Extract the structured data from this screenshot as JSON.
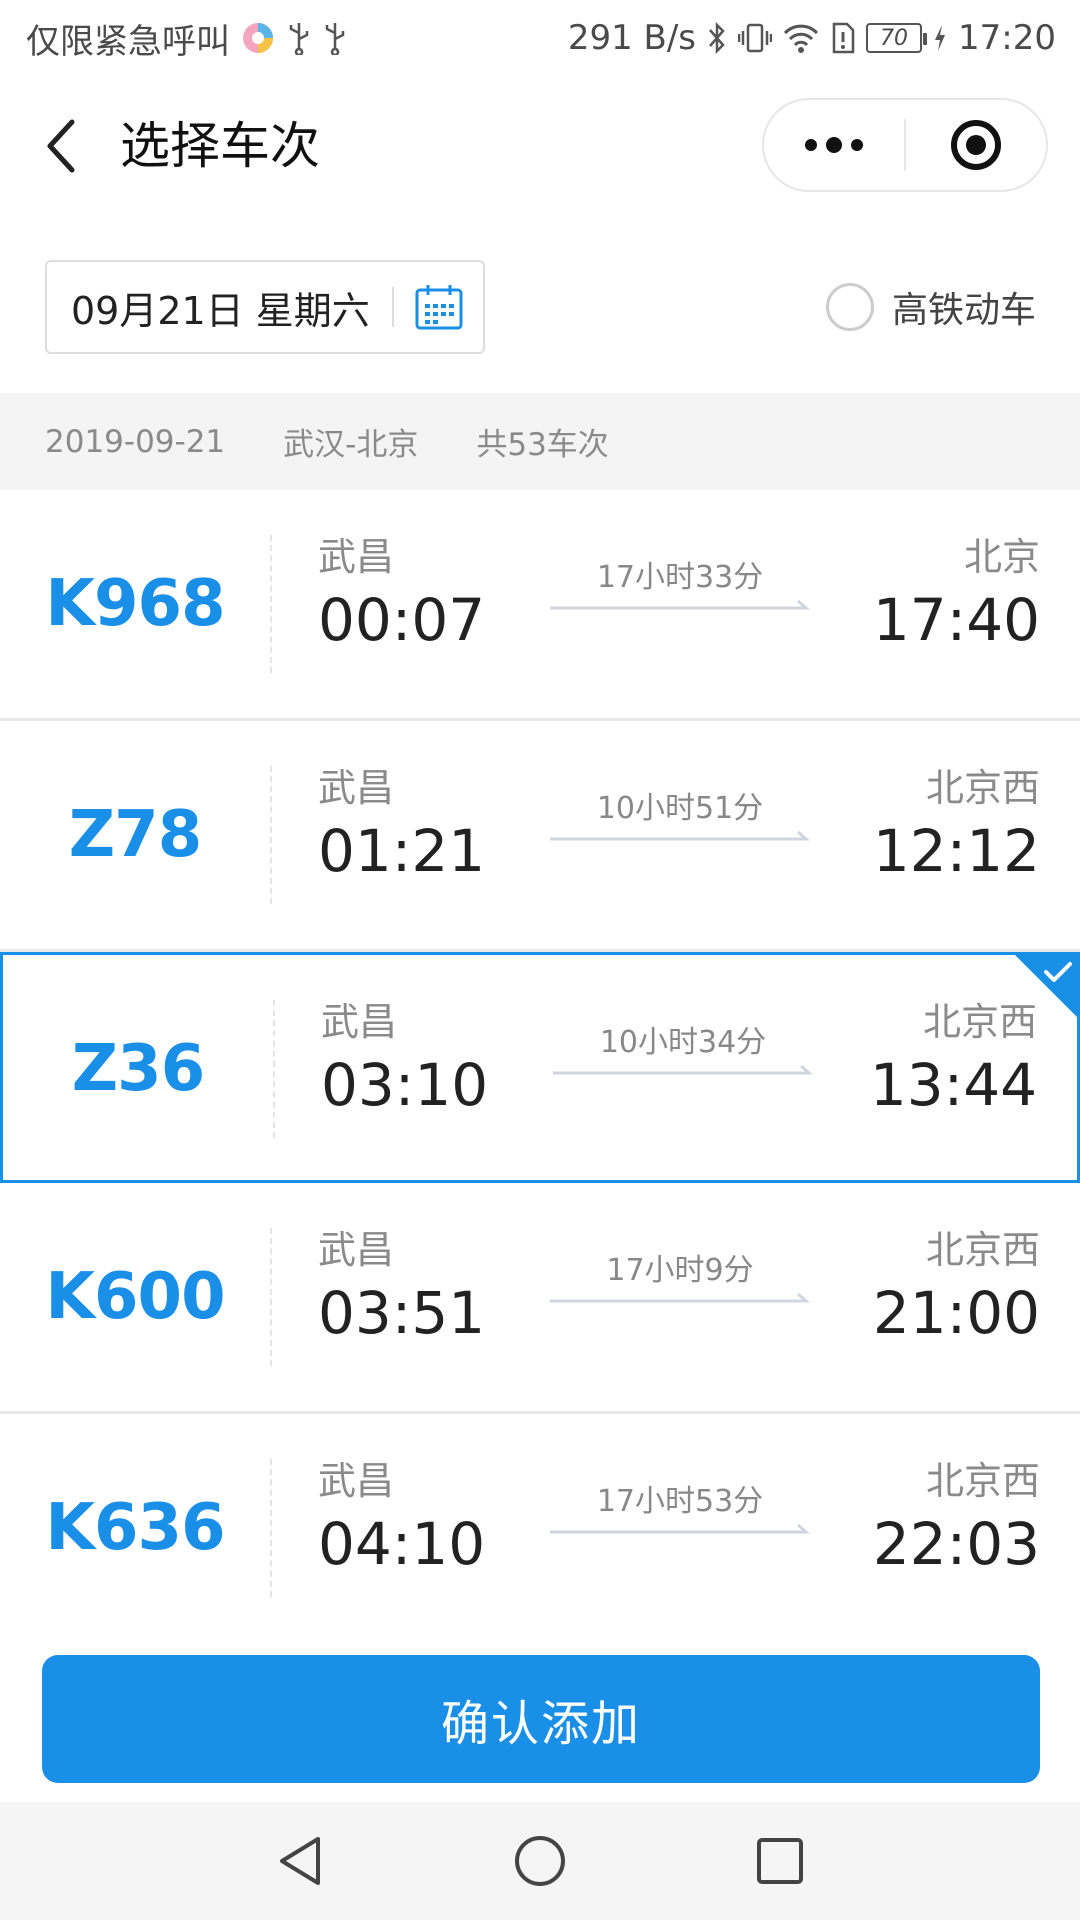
{
  "status_bar": {
    "carrier_text": "仅限紧急呼叫",
    "net_speed": "291 B/s",
    "battery": "70",
    "time": "17:20"
  },
  "nav": {
    "title": "选择车次"
  },
  "filters": {
    "date": "09月21日 星期六",
    "high_speed_label": "高铁动车",
    "high_speed_checked": false
  },
  "summary": {
    "date": "2019-09-21",
    "route": "武汉-北京",
    "count": "共53车次"
  },
  "trains": [
    {
      "number": "K968",
      "from": "武昌",
      "depart": "00:07",
      "duration": "17小时33分",
      "to": "北京",
      "arrive": "17:40",
      "selected": false
    },
    {
      "number": "Z78",
      "from": "武昌",
      "depart": "01:21",
      "duration": "10小时51分",
      "to": "北京西",
      "arrive": "12:12",
      "selected": false
    },
    {
      "number": "Z36",
      "from": "武昌",
      "depart": "03:10",
      "duration": "10小时34分",
      "to": "北京西",
      "arrive": "13:44",
      "selected": true
    },
    {
      "number": "K600",
      "from": "武昌",
      "depart": "03:51",
      "duration": "17小时9分",
      "to": "北京西",
      "arrive": "21:00",
      "selected": false
    },
    {
      "number": "K636",
      "from": "武昌",
      "depart": "04:10",
      "duration": "17小时53分",
      "to": "北京西",
      "arrive": "22:03",
      "selected": false
    }
  ],
  "confirm_label": "确认添加",
  "colors": {
    "accent": "#1a8fe8",
    "text_dark": "#222222",
    "text_muted": "#8a8a8a",
    "summary_bg": "#f4f4f4"
  },
  "icons": {
    "back": "chevron-left-icon",
    "more": "more-dots-icon",
    "close": "target-close-icon",
    "calendar": "calendar-icon",
    "selected": "checkmark-icon",
    "nav_back": "triangle-back-icon",
    "nav_home": "circle-home-icon",
    "nav_recent": "square-recent-icon"
  }
}
